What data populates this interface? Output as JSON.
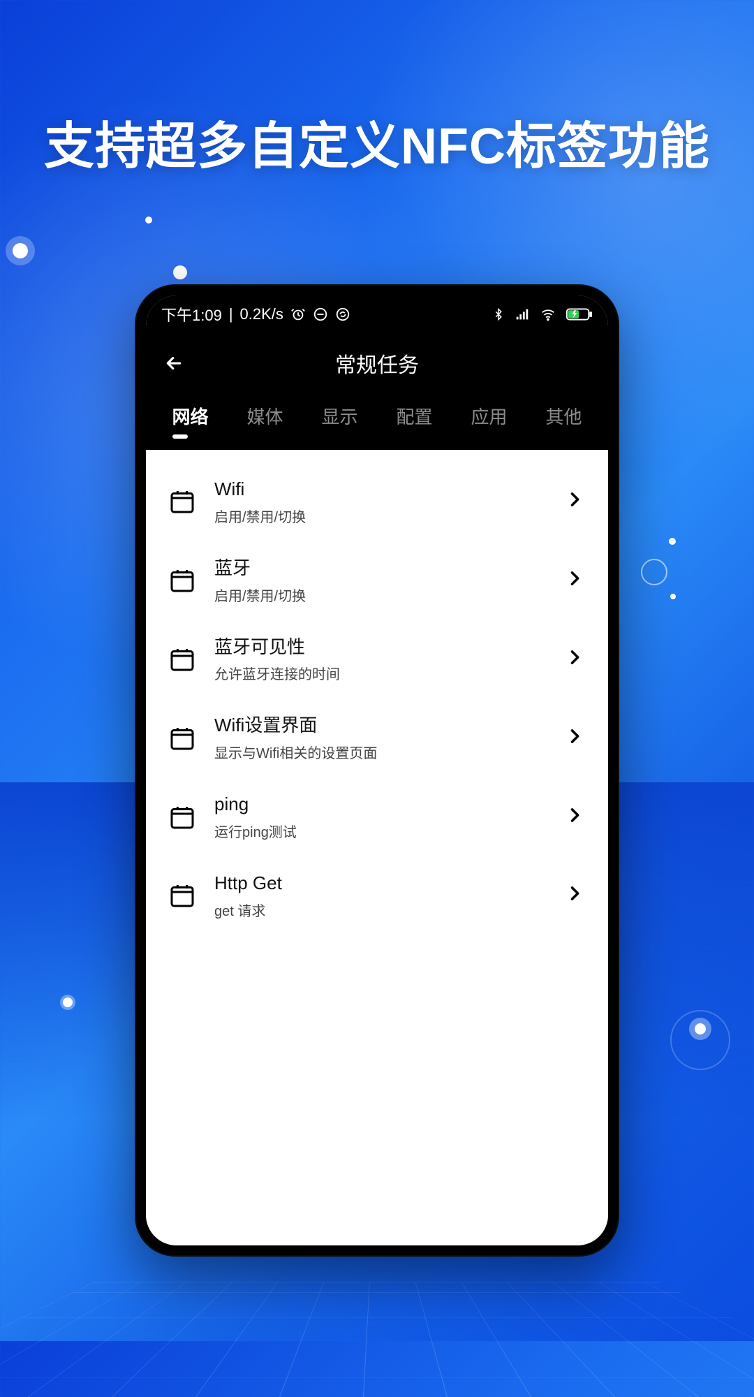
{
  "promo": {
    "heading": "支持超多自定义NFC标签功能"
  },
  "statusbar": {
    "time": "下午1:09",
    "net_speed": "0.2K/s",
    "icons": [
      "alarm-icon",
      "dnd-icon",
      "sync-icon",
      "bluetooth-icon",
      "signal-icon",
      "wifi-icon",
      "battery-icon"
    ]
  },
  "header": {
    "title": "常规任务"
  },
  "tabs": [
    {
      "label": "网络",
      "active": true
    },
    {
      "label": "媒体",
      "active": false
    },
    {
      "label": "显示",
      "active": false
    },
    {
      "label": "配置",
      "active": false
    },
    {
      "label": "应用",
      "active": false
    },
    {
      "label": "其他",
      "active": false
    }
  ],
  "items": [
    {
      "title": "Wifi",
      "subtitle": "启用/禁用/切换"
    },
    {
      "title": "蓝牙",
      "subtitle": "启用/禁用/切换"
    },
    {
      "title": "蓝牙可见性",
      "subtitle": "允许蓝牙连接的时间"
    },
    {
      "title": "Wifi设置界面",
      "subtitle": "显示与Wifi相关的设置页面"
    },
    {
      "title": "ping",
      "subtitle": "运行ping测试"
    },
    {
      "title": "Http Get",
      "subtitle": "get 请求"
    }
  ]
}
